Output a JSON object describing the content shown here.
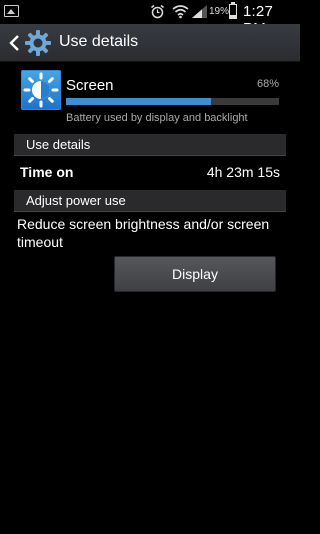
{
  "status_bar": {
    "battery_percent": "19%",
    "time": "1:27 PM",
    "icons": [
      "picture-icon",
      "alarm-icon",
      "wifi-icon",
      "signal-icon",
      "battery-icon"
    ]
  },
  "action_bar": {
    "title": "Use details",
    "icons": [
      "back-arrow-icon",
      "settings-gear-icon"
    ]
  },
  "app": {
    "name": "Screen",
    "percent_label": "68%",
    "usage_fraction": 0.68,
    "description": "Battery used by display and backlight",
    "icon": "brightness-sun-icon",
    "accent_color": "#3f8fd0"
  },
  "use_details": {
    "header": "Use details",
    "time_on_label": "Time on",
    "time_on_value": "4h 23m 15s"
  },
  "adjust": {
    "header": "Adjust power use",
    "text": "Reduce screen brightness and/or screen timeout",
    "button_label": "Display"
  }
}
